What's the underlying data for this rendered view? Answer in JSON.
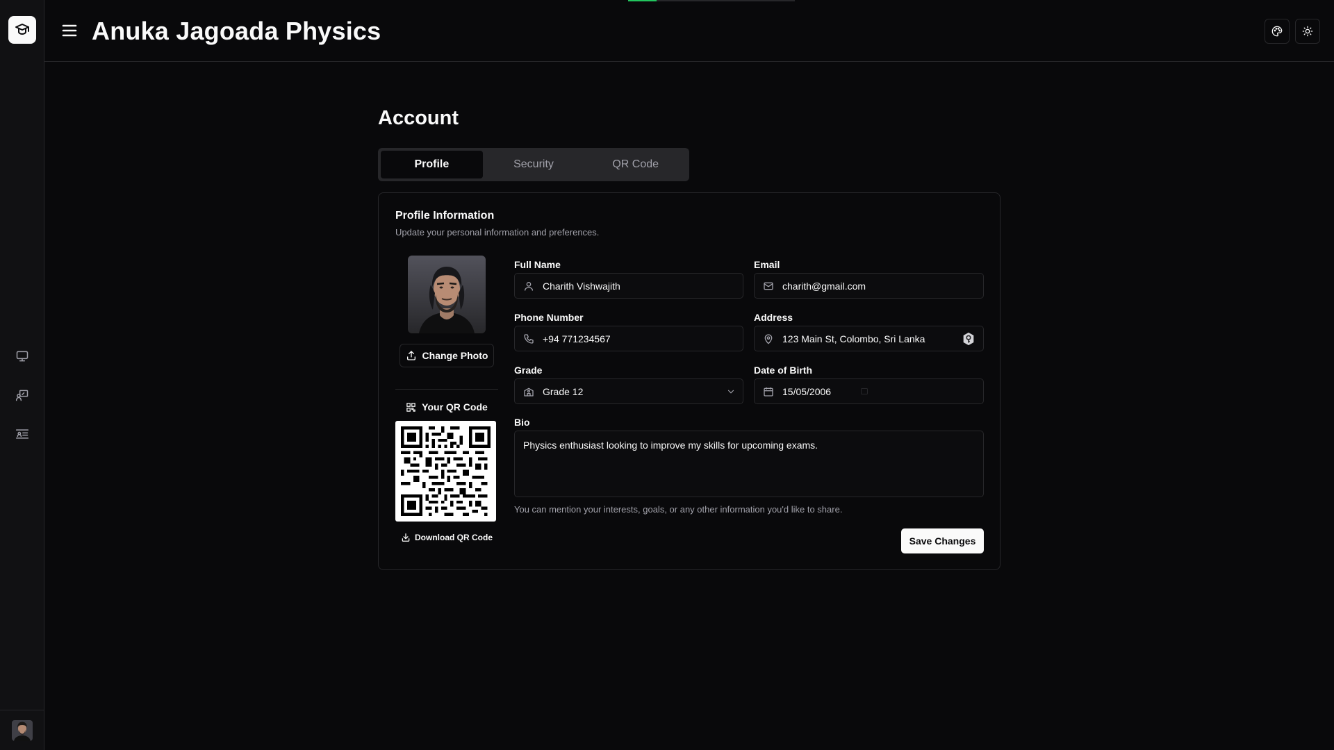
{
  "app": {
    "title": "Anuka Jagoada Physics",
    "page_progress_percent": 17
  },
  "page": {
    "title": "Account"
  },
  "tabs": [
    {
      "label": "Profile",
      "active": true
    },
    {
      "label": "Security",
      "active": false
    },
    {
      "label": "QR Code",
      "active": false
    }
  ],
  "sidebar": {
    "items": [
      {
        "icon": "monitor-icon"
      },
      {
        "icon": "presentation-icon"
      },
      {
        "icon": "users-list-icon"
      }
    ]
  },
  "card": {
    "title": "Profile Information",
    "description": "Update your personal information and preferences."
  },
  "photo": {
    "change_label": "Change Photo"
  },
  "qr": {
    "title": "Your QR Code",
    "download_label": "Download QR Code"
  },
  "fields": {
    "full_name": {
      "label": "Full Name",
      "value": "Charith Vishwajith"
    },
    "email": {
      "label": "Email",
      "value": "charith@gmail.com"
    },
    "phone": {
      "label": "Phone Number",
      "value": "+94 771234567"
    },
    "address": {
      "label": "Address",
      "value": "123 Main St, Colombo, Sri Lanka"
    },
    "grade": {
      "label": "Grade",
      "value": "Grade 12"
    },
    "dob": {
      "label": "Date of Birth",
      "value": "15/05/2006"
    }
  },
  "bio": {
    "label": "Bio",
    "value": "Physics enthusiast looking to improve my skills for upcoming exams.",
    "help": "You can mention your interests, goals, or any other information you'd like to share."
  },
  "actions": {
    "save_label": "Save Changes"
  },
  "colors": {
    "background": "#09090b",
    "border": "#27272a",
    "muted_text": "#a1a1aa",
    "progress": "#22c55e"
  }
}
